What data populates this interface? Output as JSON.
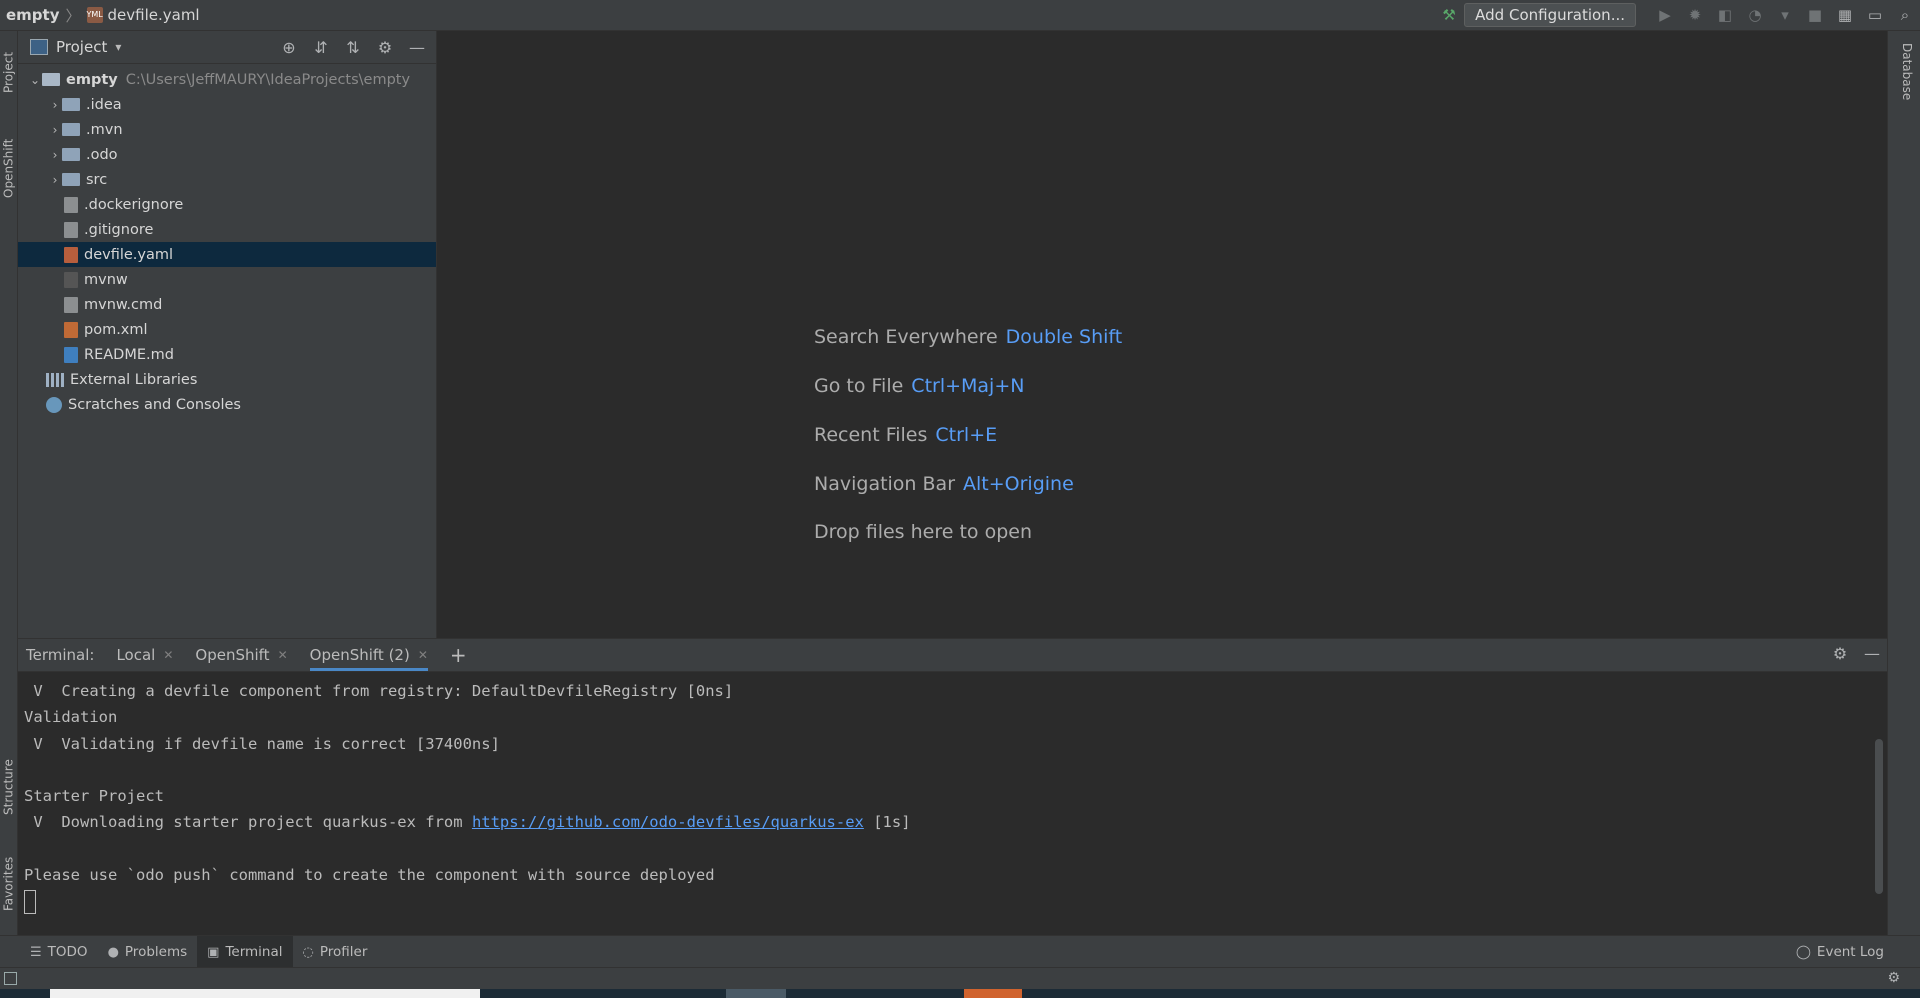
{
  "navbar": {
    "project": "empty",
    "separator": "〉",
    "file": "devfile.yaml",
    "file_icon_text": "YML"
  },
  "runbar": {
    "add_configuration": "Add Configuration...",
    "icons": [
      "build-hammer-icon",
      "run-icon",
      "debug-icon",
      "coverage-icon",
      "profile-icon",
      "more-dropdown-icon",
      "stop-icon",
      "project-structure-icon",
      "layout-icon",
      "search-icon"
    ]
  },
  "left_stripe": {
    "tabs": [
      "Project",
      "OpenShift",
      "Structure",
      "Favorites"
    ]
  },
  "right_stripe": {
    "tabs": [
      "Database"
    ]
  },
  "project_panel": {
    "title": "Project",
    "caret": "▾",
    "toolbar_icons": [
      "locate-icon",
      "expand-all-icon",
      "collapse-all-icon",
      "gear-icon",
      "hide-icon"
    ],
    "tree": [
      {
        "label": "empty",
        "path": "C:\\Users\\JeffMAURY\\IdeaProjects\\empty",
        "type": "root",
        "arrow": "⌄"
      },
      {
        "label": ".idea",
        "type": "folder",
        "arrow": "›"
      },
      {
        "label": ".mvn",
        "type": "folder",
        "arrow": "›"
      },
      {
        "label": ".odo",
        "type": "folder",
        "arrow": "›"
      },
      {
        "label": "src",
        "type": "folder",
        "arrow": "›"
      },
      {
        "label": ".dockerignore",
        "type": "file"
      },
      {
        "label": ".gitignore",
        "type": "file"
      },
      {
        "label": "devfile.yaml",
        "type": "yml",
        "selected": true
      },
      {
        "label": "mvnw",
        "type": "sh"
      },
      {
        "label": "mvnw.cmd",
        "type": "file"
      },
      {
        "label": "pom.xml",
        "type": "xml"
      },
      {
        "label": "README.md",
        "type": "md"
      },
      {
        "label": "External Libraries",
        "type": "lib"
      },
      {
        "label": "Scratches and Consoles",
        "type": "scratch"
      }
    ]
  },
  "editor_hints": [
    {
      "text": "Search Everywhere",
      "key": "Double Shift"
    },
    {
      "text": "Go to File",
      "key": "Ctrl+Maj+N"
    },
    {
      "text": "Recent Files",
      "key": "Ctrl+E"
    },
    {
      "text": "Navigation Bar",
      "key": "Alt+Origine"
    },
    {
      "text": "Drop files here to open",
      "key": ""
    }
  ],
  "terminal": {
    "label": "Terminal:",
    "tabs": [
      {
        "label": "Local",
        "active": false
      },
      {
        "label": "OpenShift",
        "active": false
      },
      {
        "label": "OpenShift (2)",
        "active": true
      }
    ],
    "close_glyph": "✕",
    "add_glyph": "+",
    "lines": [
      " V  Creating a devfile component from registry: DefaultDevfileRegistry [0ns]",
      "Validation",
      " V  Validating if devfile name is correct [37400ns]",
      "",
      "Starter Project"
    ],
    "download_prefix": " V  Downloading starter project quarkus-ex from ",
    "download_link": "https://github.com/odo-devfiles/quarkus-ex",
    "download_suffix": " [1s]",
    "final_line": "Please use `odo push` command to create the component with source deployed"
  },
  "tool_windows": [
    {
      "label": "TODO",
      "icon": "list-icon",
      "active": false
    },
    {
      "label": "Problems",
      "icon": "problems-icon",
      "active": false
    },
    {
      "label": "Terminal",
      "icon": "terminal-icon",
      "active": true
    },
    {
      "label": "Profiler",
      "icon": "profiler-icon",
      "active": false
    }
  ],
  "event_log": "Event Log",
  "colors": {
    "accent_blue": "#589df6",
    "selection": "#0d293e",
    "panel_bg": "#3c3f41",
    "editor_bg": "#2b2b2b"
  }
}
